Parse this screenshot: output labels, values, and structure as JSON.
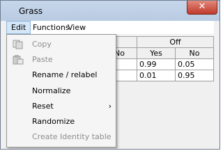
{
  "window": {
    "title": "Grass",
    "close_glyph": "✕"
  },
  "menubar": {
    "items": [
      {
        "label": "Edit"
      },
      {
        "label": "Functions"
      },
      {
        "label": "View"
      }
    ]
  },
  "table": {
    "header_group": "Off",
    "col_headers": [
      "No",
      "Yes",
      "No"
    ],
    "rows": [
      [
        "0.99",
        "0.05"
      ],
      [
        "0.01",
        "0.95"
      ]
    ]
  },
  "edit_menu": {
    "items": [
      {
        "label": "Copy",
        "enabled": false,
        "icon": "copy-icon"
      },
      {
        "label": "Paste",
        "enabled": false,
        "icon": "paste-icon"
      },
      {
        "label": "Rename / relabel",
        "enabled": true
      },
      {
        "label": "Normalize",
        "enabled": true
      },
      {
        "label": "Reset",
        "enabled": true,
        "submenu": true,
        "arrow": "›"
      },
      {
        "label": "Randomize",
        "enabled": true
      },
      {
        "label": "Create Identity table",
        "enabled": false
      }
    ]
  }
}
